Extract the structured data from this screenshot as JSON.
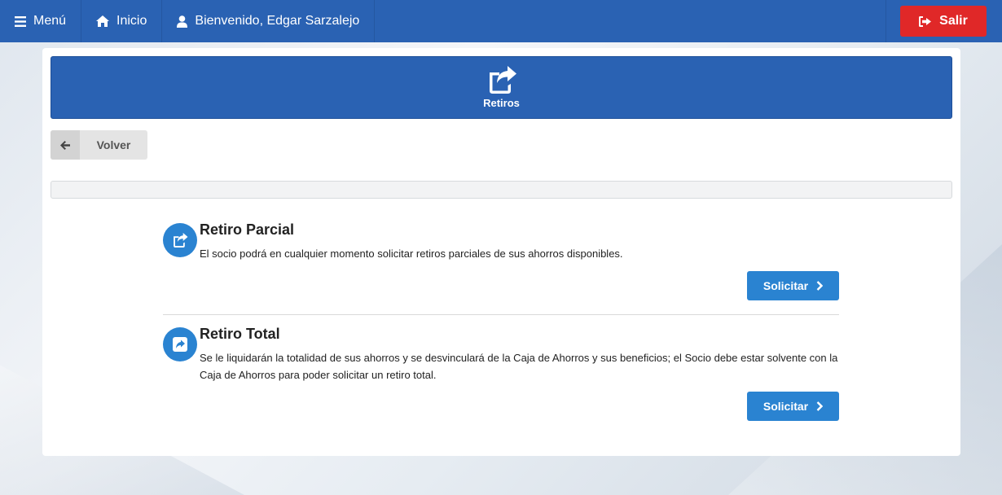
{
  "navbar": {
    "menu_label": "Menú",
    "home_label": "Inicio",
    "welcome_label": "Bienvenido, Edgar Sarzalejo",
    "logout_label": "Salir"
  },
  "header": {
    "title": "Retiros"
  },
  "back_button": {
    "label": "Volver"
  },
  "options": [
    {
      "title": "Retiro Parcial",
      "description": "El socio podrá en cualquier momento solicitar retiros parciales de sus ahorros disponibles.",
      "button_label": "Solicitar"
    },
    {
      "title": "Retiro Total",
      "description": "Se le liquidarán la totalidad de sus ahorros y se desvinculará de la Caja de Ahorros y sus beneficios; el Socio debe estar solvente con la Caja de Ahorros para poder solicitar un retiro total.",
      "button_label": "Solicitar"
    }
  ],
  "colors": {
    "navbar": "#2a62b3",
    "logout": "#e02828",
    "accent": "#2a83d1"
  }
}
